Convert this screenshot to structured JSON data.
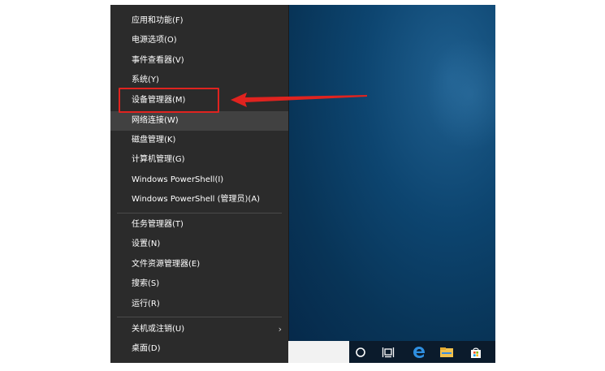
{
  "menu": {
    "items": [
      {
        "label": "应用和功能(F)"
      },
      {
        "label": "电源选项(O)"
      },
      {
        "label": "事件查看器(V)"
      },
      {
        "label": "系统(Y)"
      },
      {
        "label": "设备管理器(M)"
      },
      {
        "label": "网络连接(W)"
      },
      {
        "label": "磁盘管理(K)"
      },
      {
        "label": "计算机管理(G)"
      },
      {
        "label": "Windows PowerShell(I)"
      },
      {
        "label": "Windows PowerShell (管理员)(A)"
      },
      {
        "label": "任务管理器(T)"
      },
      {
        "label": "设置(N)"
      },
      {
        "label": "文件资源管理器(E)"
      },
      {
        "label": "搜索(S)"
      },
      {
        "label": "运行(R)"
      },
      {
        "label": "关机或注销(U)"
      },
      {
        "label": "桌面(D)"
      }
    ],
    "hovered_item": "网络连接(W)",
    "highlighted_item": "设备管理器(M)",
    "submenu_glyph": "›"
  },
  "annotation": {
    "box_color": "#e0231f",
    "arrow_color": "#e0231f"
  },
  "taskbar": {
    "icons": [
      "cortana-circle-icon",
      "task-view-icon",
      "edge-browser-icon",
      "file-explorer-icon",
      "store-icon"
    ]
  },
  "colors": {
    "menu_bg": "#2b2b2b",
    "menu_hover": "#414141",
    "desktop_accent": "#0d4570",
    "taskbar_bg": "#0b1b2c"
  }
}
